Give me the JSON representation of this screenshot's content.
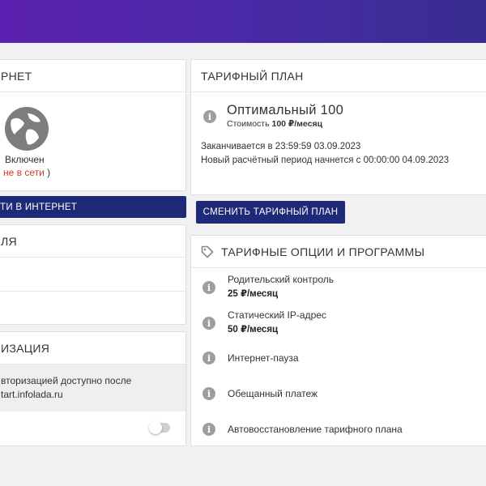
{
  "colors": {
    "header_gradient_start": "#5b22b0",
    "header_gradient_end": "#372d8f",
    "button_navy": "#1e2a78",
    "offline_red": "#d43a2a",
    "info_icon_gray": "#9e9e9e"
  },
  "internet": {
    "title": "РНЕТ",
    "icon": "globe-icon",
    "status": "Включен",
    "online_value": "не в сети",
    "online_paren_close": " )"
  },
  "exit_button_label": "ТИ В ИНТЕРНЕТ",
  "parent": {
    "title": "ЛЯ"
  },
  "auth": {
    "title": "ИЗАЦИЯ",
    "note_line1": "вторизацией доступно после",
    "note_line2": "tart.infolada.ru",
    "toggle_on": false
  },
  "tariff": {
    "title": "ТАРИФНЫЙ ПЛАН",
    "plan_name": "Оптимальный 100",
    "cost_label": "Стоимость",
    "cost_value": "100 ₽/месяц",
    "until": "Заканчивается в 23:59:59 03.09.2023",
    "next_period": "Новый расчётный период начнется с 00:00:00 04.09.2023"
  },
  "change_button_label": "СМЕНИТЬ ТАРИФНЫЙ ПЛАН",
  "options": {
    "title": "ТАРИФНЫЕ ОПЦИИ И ПРОГРАММЫ",
    "items": [
      {
        "name": "Родительский контроль",
        "price": "25 ₽/месяц"
      },
      {
        "name": "Статический IP-адрес",
        "price": "50 ₽/месяц"
      },
      {
        "name": "Интернет-пауза"
      },
      {
        "name": "Обещанный платеж"
      },
      {
        "name": "Автовосстановление тарифного плана"
      }
    ]
  }
}
